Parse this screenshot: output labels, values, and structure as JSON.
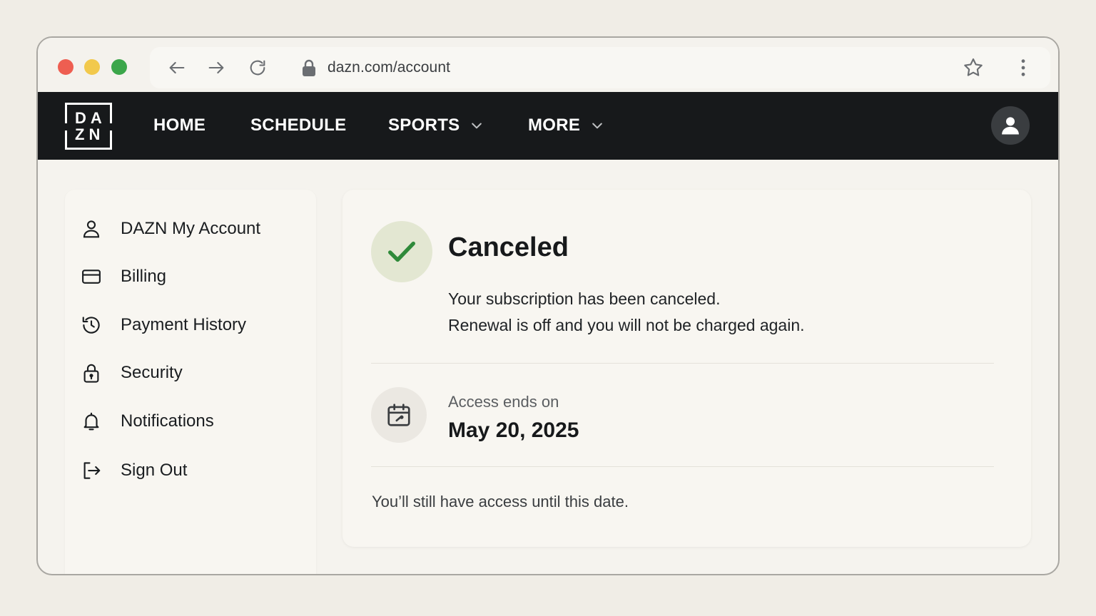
{
  "browser": {
    "url": "dazn.com/account"
  },
  "nav": {
    "logo_top": "DA",
    "logo_bottom": "ZN",
    "items": [
      {
        "label": "HOME"
      },
      {
        "label": "SCHEDULE"
      },
      {
        "label": "SPORTS"
      },
      {
        "label": "MORE"
      }
    ]
  },
  "sidebar": {
    "items": [
      {
        "label": "DAZN My Account",
        "icon": "user-icon"
      },
      {
        "label": "Billing",
        "icon": "credit-card-icon"
      },
      {
        "label": "Payment History",
        "icon": "history-icon"
      },
      {
        "label": "Security",
        "icon": "lock-icon"
      },
      {
        "label": "Notifications",
        "icon": "bell-icon"
      },
      {
        "label": "Sign Out",
        "icon": "sign-out-icon"
      }
    ]
  },
  "status": {
    "title": "Canceled",
    "line1": "Your subscription has been canceled.",
    "line2": "Renewal is off and you will not be charged again.",
    "access_label": "Access ends on",
    "access_date": "May 20, 2025",
    "footnote": "You’ll still have access until this date."
  },
  "colors": {
    "nav_bg": "#17191b",
    "check_green": "#2f8a3a",
    "check_bg": "#e3e7d2"
  }
}
